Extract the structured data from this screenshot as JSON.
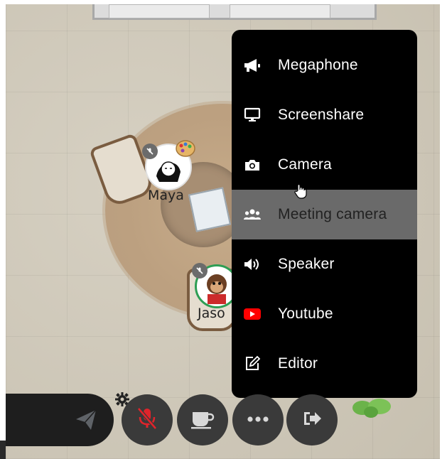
{
  "scene": {
    "avatars": [
      {
        "name": "Maya"
      },
      {
        "name": "Jaso"
      }
    ]
  },
  "menu": {
    "items": [
      {
        "label": "Megaphone",
        "icon": "megaphone-icon"
      },
      {
        "label": "Screenshare",
        "icon": "monitor-icon"
      },
      {
        "label": "Camera",
        "icon": "camera-icon"
      },
      {
        "label": "Meeting camera",
        "icon": "users-icon",
        "highlighted": true
      },
      {
        "label": "Speaker",
        "icon": "speaker-icon"
      },
      {
        "label": "Youtube",
        "icon": "youtube-icon"
      },
      {
        "label": "Editor",
        "icon": "edit-icon"
      }
    ]
  },
  "toolbar": {
    "buttons": [
      {
        "icon": "send-icon"
      },
      {
        "icon": "microphone-muted-icon"
      },
      {
        "icon": "coffee-icon"
      },
      {
        "icon": "more-icon"
      },
      {
        "icon": "exit-icon"
      }
    ]
  },
  "colors": {
    "menu_bg": "#000000",
    "highlight_bg": "#6a6a6a",
    "youtube_red": "#ff0000",
    "mic_muted_red": "#e0242b",
    "toolbar_button": "#3a3a3a"
  }
}
